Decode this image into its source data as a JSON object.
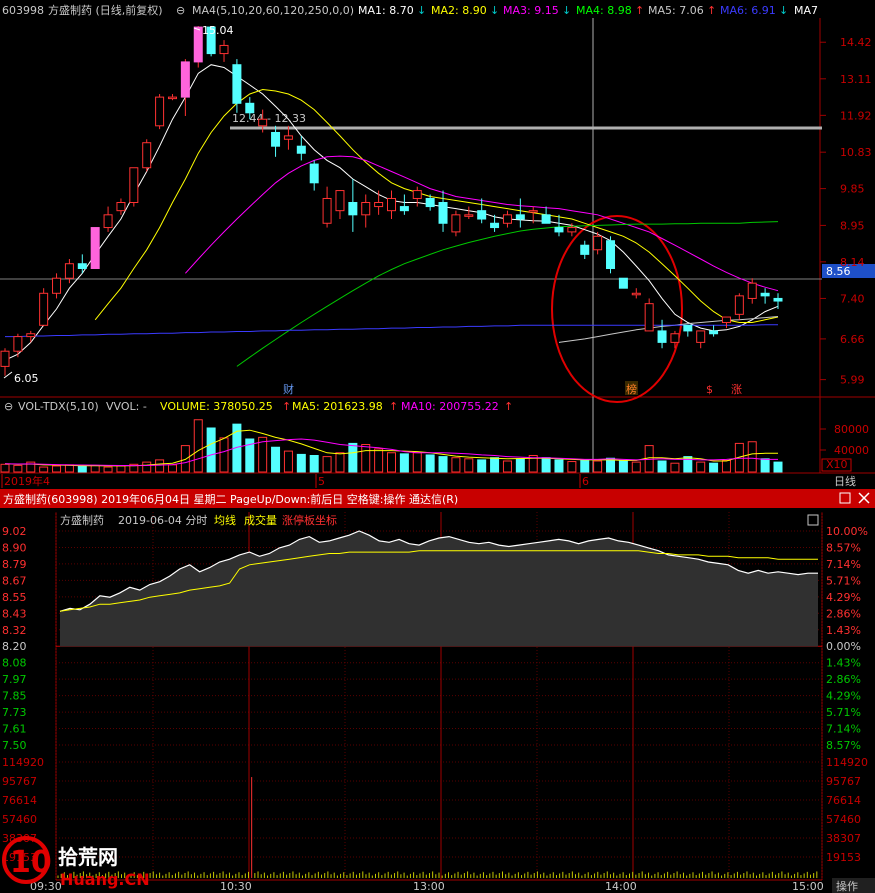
{
  "header": {
    "code": "603998",
    "name_period": "方盛制药 (日线,前复权)",
    "ma_label": "MA4(5,10,20,60,120,250,0,0)",
    "ma_items": [
      {
        "label": "MA1: 8.70",
        "arrow": "↓",
        "color": "#ffffff"
      },
      {
        "label": "MA2: 8.90",
        "arrow": "↓",
        "color": "#ffff00"
      },
      {
        "label": "MA3: 9.15",
        "arrow": "↓",
        "color": "#ff00ff"
      },
      {
        "label": "MA4: 8.98",
        "arrow": "↑",
        "color": "#00ff00"
      },
      {
        "label": "MA5: 7.06",
        "arrow": "↑",
        "color": "#c8c8c8"
      },
      {
        "label": "MA6: 6.91",
        "arrow": "↓",
        "color": "#3b3bff"
      },
      {
        "label": "MA7",
        "arrow": "",
        "color": "#ffffff"
      }
    ]
  },
  "daily": {
    "y_ticks": [
      "14.42",
      "13.11",
      "11.92",
      "10.83",
      "9.85",
      "8.95",
      "8.14",
      "7.40",
      "6.66",
      "5.99"
    ],
    "current_price_label": "8.56",
    "high_label": "15.04",
    "low_label": "6.05",
    "gap_label": "12.44 - 12.33",
    "month_labels": [
      "2019年4",
      "5",
      "6"
    ],
    "markers": [
      {
        "text": "财",
        "color": "#6495ed"
      },
      {
        "text": "榜",
        "color": "#ff7f27"
      },
      {
        "text": "$",
        "color": "#ff3030"
      },
      {
        "text": "涨",
        "color": "#ff3030"
      }
    ],
    "period_label": "日线"
  },
  "volume": {
    "title": "VOL-TDX(5,10)",
    "vvol": "VVOL: -",
    "volume_label": "VOLUME: 378050.25",
    "ma5_label": "MA5: 201623.98",
    "ma10_label": "MA10: 200755.22",
    "arrow": "↑",
    "y_ticks": [
      "80000",
      "40000"
    ],
    "unit": "X10"
  },
  "window_bar": {
    "title": "方盛制药(603998) 2019年06月04日 星期二 PageUp/Down:前后日 空格键:操作 通达信(R)"
  },
  "intraday": {
    "name": "方盛制药",
    "date": "2019-06-04 分时",
    "avg_label": "均线",
    "vol_label": "成交量",
    "limit_label": "涨停板坐标",
    "price_ticks": [
      "9.02",
      "8.90",
      "8.79",
      "8.67",
      "8.55",
      "8.43",
      "8.32",
      "8.20",
      "8.08",
      "7.97",
      "7.85",
      "7.73",
      "7.61",
      "7.50"
    ],
    "pct_ticks": [
      "10.00%",
      "8.57%",
      "7.14%",
      "5.71%",
      "4.29%",
      "2.86%",
      "1.43%",
      "0.00%",
      "1.43%",
      "2.86%",
      "4.29%",
      "5.71%",
      "7.14%",
      "8.57%"
    ],
    "vol_ticks": [
      "114920",
      "95767",
      "76614",
      "57460",
      "38307",
      "19153"
    ],
    "time_labels": [
      "09:30",
      "10:30",
      "13:00",
      "14:00",
      "15:00"
    ],
    "operate_label": "操作",
    "watermark_brand": "拾荒网",
    "watermark_url": "Huang.CN"
  },
  "chart_data": [
    {
      "type": "candlestick",
      "title": "603998 方盛制药 日线 前复权",
      "ylim": [
        5.8,
        15.2
      ],
      "y_scale": "log",
      "candles": [
        [
          6.2,
          6.5,
          6.05,
          6.45
        ],
        [
          6.45,
          6.75,
          6.35,
          6.7
        ],
        [
          6.7,
          6.8,
          6.6,
          6.75
        ],
        [
          6.9,
          7.6,
          6.9,
          7.5
        ],
        [
          7.5,
          7.9,
          7.4,
          7.8
        ],
        [
          7.8,
          8.2,
          7.7,
          8.1
        ],
        [
          8.1,
          8.3,
          7.9,
          8.0
        ],
        [
          8.0,
          8.9,
          8.0,
          8.9
        ],
        [
          8.9,
          9.4,
          8.8,
          9.2
        ],
        [
          9.3,
          9.6,
          9.2,
          9.5
        ],
        [
          9.5,
          10.4,
          9.4,
          10.4
        ],
        [
          10.4,
          11.2,
          10.3,
          11.1
        ],
        [
          11.6,
          12.6,
          11.5,
          12.5
        ],
        [
          12.5,
          12.6,
          12.4,
          12.5
        ],
        [
          12.5,
          13.8,
          11.9,
          13.7
        ],
        [
          13.7,
          15.04,
          13.5,
          15.0
        ],
        [
          15.0,
          15.0,
          13.9,
          14.0
        ],
        [
          14.0,
          14.5,
          13.7,
          14.3
        ],
        [
          13.6,
          13.8,
          12.0,
          12.3
        ],
        [
          12.3,
          12.5,
          11.8,
          12.0
        ],
        [
          11.6,
          12.1,
          11.4,
          11.8
        ],
        [
          11.4,
          11.6,
          10.7,
          11.0
        ],
        [
          11.2,
          11.6,
          10.9,
          11.3
        ],
        [
          11.0,
          11.3,
          10.6,
          10.8
        ],
        [
          10.5,
          10.6,
          9.8,
          10.0
        ],
        [
          9.0,
          9.9,
          8.9,
          9.6
        ],
        [
          9.3,
          9.8,
          9.1,
          9.8
        ],
        [
          9.5,
          10.1,
          8.8,
          9.2
        ],
        [
          9.2,
          9.7,
          8.9,
          9.5
        ],
        [
          9.4,
          9.8,
          9.2,
          9.5
        ],
        [
          9.3,
          9.8,
          9.1,
          9.6
        ],
        [
          9.4,
          9.7,
          9.2,
          9.3
        ],
        [
          9.6,
          9.9,
          9.4,
          9.8
        ],
        [
          9.6,
          9.7,
          9.3,
          9.4
        ],
        [
          9.5,
          9.8,
          8.8,
          9.0
        ],
        [
          8.8,
          9.3,
          8.7,
          9.2
        ],
        [
          9.2,
          9.4,
          9.1,
          9.2
        ],
        [
          9.3,
          9.6,
          9.0,
          9.1
        ],
        [
          9.0,
          9.2,
          8.8,
          8.9
        ],
        [
          9.0,
          9.3,
          8.9,
          9.2
        ],
        [
          9.2,
          9.6,
          8.9,
          9.1
        ],
        [
          9.3,
          9.4,
          9.0,
          9.3
        ],
        [
          9.2,
          9.4,
          9.0,
          9.0
        ],
        [
          8.9,
          9.2,
          8.7,
          8.8
        ],
        [
          8.8,
          9.0,
          8.7,
          8.9
        ],
        [
          8.5,
          8.6,
          8.2,
          8.3
        ],
        [
          8.4,
          8.8,
          8.3,
          8.7
        ],
        [
          8.6,
          8.7,
          7.9,
          8.0
        ],
        [
          7.8,
          7.8,
          7.6,
          7.6
        ],
        [
          7.5,
          7.6,
          7.4,
          7.5
        ],
        [
          6.8,
          7.4,
          6.8,
          7.3
        ],
        [
          6.8,
          7.0,
          6.5,
          6.6
        ],
        [
          6.6,
          6.8,
          6.5,
          6.75
        ],
        [
          6.9,
          6.9,
          6.7,
          6.8
        ],
        [
          6.6,
          6.8,
          6.5,
          6.8
        ],
        [
          6.8,
          6.9,
          6.7,
          6.75
        ],
        [
          6.95,
          7.05,
          6.85,
          7.05
        ],
        [
          7.1,
          7.5,
          7.0,
          7.45
        ],
        [
          7.4,
          7.8,
          7.3,
          7.7
        ],
        [
          7.5,
          7.6,
          7.3,
          7.45
        ],
        [
          7.4,
          7.5,
          7.2,
          7.35
        ]
      ],
      "ma": {
        "MA1": [
          6.3,
          6.4,
          6.6,
          6.9,
          7.2,
          7.6,
          7.9,
          8.3,
          8.7,
          9.1,
          9.7,
          10.3,
          11.0,
          11.8,
          12.5,
          13.3,
          13.6,
          13.5,
          13.2,
          12.9,
          12.6,
          12.2,
          11.8,
          11.3,
          10.9,
          10.6,
          10.4,
          10.1,
          9.9,
          9.7,
          9.55,
          9.5,
          9.5,
          9.45,
          9.4,
          9.35,
          9.3,
          9.25,
          9.15,
          9.1,
          9.08,
          9.06,
          9.05,
          9.0,
          8.95,
          8.85,
          8.75,
          8.6,
          8.35,
          8.05,
          7.75,
          7.4,
          7.1,
          6.95,
          6.85,
          6.8,
          6.82,
          6.88,
          7.0,
          7.15,
          7.25
        ],
        "MA2": [
          null,
          null,
          null,
          null,
          null,
          null,
          null,
          7.0,
          7.3,
          7.6,
          8.0,
          8.4,
          8.9,
          9.5,
          10.1,
          10.8,
          11.4,
          11.9,
          12.3,
          12.6,
          12.75,
          12.7,
          12.6,
          12.4,
          12.1,
          11.7,
          11.3,
          10.9,
          10.55,
          10.25,
          10.0,
          9.85,
          9.75,
          9.65,
          9.6,
          9.55,
          9.5,
          9.45,
          9.4,
          9.35,
          9.3,
          9.25,
          9.2,
          9.15,
          9.1,
          9.0,
          8.9,
          8.8,
          8.7,
          8.55,
          8.35,
          8.1,
          7.85,
          7.6,
          7.35,
          7.15,
          7.0,
          6.95,
          6.95,
          7.0,
          7.05
        ],
        "MA3": [
          null,
          null,
          null,
          null,
          null,
          null,
          null,
          null,
          null,
          null,
          null,
          null,
          null,
          null,
          7.9,
          8.2,
          8.5,
          8.8,
          9.1,
          9.4,
          9.7,
          10.0,
          10.25,
          10.45,
          10.6,
          10.7,
          10.72,
          10.7,
          10.6,
          10.45,
          10.3,
          10.15,
          10.0,
          9.85,
          9.75,
          9.65,
          9.6,
          9.55,
          9.5,
          9.45,
          9.42,
          9.4,
          9.37,
          9.35,
          9.3,
          9.25,
          9.2,
          9.1,
          9.0,
          8.9,
          8.8,
          8.65,
          8.5,
          8.35,
          8.2,
          8.05,
          7.92,
          7.8,
          7.7,
          7.62,
          7.55
        ],
        "MA4": [
          null,
          null,
          null,
          null,
          null,
          null,
          null,
          null,
          null,
          null,
          null,
          null,
          null,
          null,
          null,
          null,
          null,
          null,
          6.2,
          6.35,
          6.5,
          6.65,
          6.8,
          6.95,
          7.1,
          7.25,
          7.4,
          7.55,
          7.7,
          7.85,
          7.98,
          8.1,
          8.2,
          8.3,
          8.4,
          8.48,
          8.56,
          8.63,
          8.7,
          8.76,
          8.82,
          8.86,
          8.89,
          8.92,
          8.93,
          8.94,
          8.95,
          8.96,
          8.97,
          8.98,
          8.98,
          8.98,
          8.99,
          8.99,
          9.0,
          9.0,
          9.0,
          9.0,
          9.02,
          9.03,
          9.04
        ],
        "MA5": [
          null,
          null,
          null,
          null,
          null,
          null,
          null,
          null,
          null,
          null,
          null,
          null,
          null,
          null,
          null,
          null,
          null,
          null,
          null,
          null,
          null,
          null,
          null,
          null,
          null,
          null,
          null,
          null,
          null,
          null,
          null,
          null,
          null,
          null,
          null,
          null,
          null,
          null,
          null,
          null,
          null,
          null,
          null,
          6.6,
          6.63,
          6.66,
          6.7,
          6.74,
          6.78,
          6.82,
          6.85,
          6.88,
          6.9,
          6.93,
          6.95,
          6.97,
          6.99,
          7.0,
          7.02,
          7.04,
          7.06
        ],
        "MA6": [
          6.7,
          6.7,
          6.71,
          6.71,
          6.72,
          6.72,
          6.73,
          6.73,
          6.74,
          6.74,
          6.75,
          6.75,
          6.76,
          6.76,
          6.77,
          6.77,
          6.78,
          6.78,
          6.79,
          6.79,
          6.8,
          6.8,
          6.81,
          6.81,
          6.82,
          6.82,
          6.83,
          6.83,
          6.84,
          6.84,
          6.85,
          6.85,
          6.86,
          6.86,
          6.87,
          6.87,
          6.88,
          6.88,
          6.89,
          6.89,
          6.9,
          6.9,
          6.9,
          6.9,
          6.9,
          6.9,
          6.9,
          6.9,
          6.9,
          6.9,
          6.9,
          6.9,
          6.9,
          6.9,
          6.9,
          6.9,
          6.9,
          6.9,
          6.9,
          6.91,
          6.91
        ]
      }
    },
    {
      "type": "bar",
      "title": "VOL-TDX(5,10)",
      "unit": "X10",
      "ylim": [
        0,
        100000
      ],
      "values": [
        14000,
        12000,
        18000,
        9000,
        11000,
        13000,
        10000,
        12000,
        9000,
        11000,
        14000,
        18000,
        22000,
        13000,
        48000,
        95000,
        80000,
        62000,
        87000,
        60000,
        63000,
        45000,
        38000,
        32000,
        30000,
        28000,
        35000,
        52000,
        50000,
        42000,
        35000,
        33000,
        35000,
        31000,
        28000,
        26000,
        24000,
        22000,
        26000,
        20000,
        24000,
        30000,
        26000,
        22000,
        19000,
        22000,
        20000,
        25000,
        21000,
        18000,
        48000,
        20000,
        16000,
        28000,
        18000,
        16000,
        21000,
        52000,
        55000,
        24000,
        18000
      ],
      "ma5": [
        15000,
        14000,
        14500,
        13000,
        12800,
        12000,
        11500,
        11200,
        11000,
        11000,
        11500,
        12500,
        14500,
        16000,
        23000,
        39000,
        51000,
        61000,
        74000,
        76000,
        70000,
        63000,
        58000,
        51000,
        43000,
        35000,
        33000,
        35000,
        39000,
        39000,
        39000,
        38000,
        37000,
        35000,
        32000,
        29000,
        27000,
        26000,
        25000,
        24000,
        24500,
        25000,
        25000,
        24000,
        23000,
        22000,
        22000,
        22000,
        21000,
        21000,
        26000,
        26000,
        24000,
        26000,
        24000,
        20000,
        20000,
        27000,
        33000,
        34000,
        34000
      ],
      "ma10": [
        15000,
        14500,
        14800,
        14000,
        13500,
        13000,
        12800,
        12500,
        12000,
        11800,
        11700,
        11800,
        12500,
        13500,
        17000,
        24000,
        31000,
        37000,
        45000,
        50000,
        55000,
        57000,
        59000,
        60000,
        58000,
        54000,
        50000,
        48000,
        46000,
        44000,
        41000,
        37000,
        35000,
        35000,
        35000,
        34000,
        33000,
        31000,
        30000,
        28000,
        27000,
        26000,
        26000,
        25000,
        24000,
        23000,
        23000,
        24000,
        23000,
        22000,
        23000,
        24000,
        23000,
        23000,
        22000,
        22000,
        23000,
        25000,
        25000,
        23000,
        23000
      ]
    },
    {
      "type": "line",
      "title": "方盛制药 2019-06-04 分时",
      "ylim": [
        7.38,
        9.02
      ],
      "prev_close": 8.2,
      "price": [
        8.45,
        8.47,
        8.46,
        8.5,
        8.56,
        8.55,
        8.58,
        8.62,
        8.6,
        8.64,
        8.66,
        8.7,
        8.75,
        8.78,
        8.73,
        8.76,
        8.8,
        8.82,
        8.85,
        8.87,
        8.84,
        8.86,
        8.9,
        8.92,
        8.96,
        8.98,
        8.94,
        8.95,
        8.97,
        8.99,
        9.02,
        8.99,
        8.95,
        8.94,
        8.96,
        8.93,
        8.92,
        8.95,
        8.97,
        8.98,
        8.96,
        8.94,
        8.93,
        8.94,
        8.92,
        8.91,
        8.92,
        8.93,
        8.94,
        8.95,
        8.96,
        8.95,
        8.93,
        8.95,
        8.96,
        8.97,
        8.95,
        8.94,
        8.92,
        8.9,
        8.88,
        8.85,
        8.84,
        8.83,
        8.82,
        8.8,
        8.79,
        8.78,
        8.74,
        8.72,
        8.74,
        8.72,
        8.73,
        8.72,
        8.71,
        8.72,
        8.72
      ],
      "avg": [
        8.45,
        8.46,
        8.47,
        8.48,
        8.5,
        8.5,
        8.51,
        8.52,
        8.53,
        8.55,
        8.56,
        8.57,
        8.58,
        8.6,
        8.61,
        8.62,
        8.63,
        8.65,
        8.75,
        8.78,
        8.79,
        8.8,
        8.81,
        8.82,
        8.83,
        8.84,
        8.85,
        8.86,
        8.86,
        8.87,
        8.87,
        8.87,
        8.87,
        8.87,
        8.87,
        8.87,
        8.88,
        8.88,
        8.88,
        8.88,
        8.88,
        8.88,
        8.88,
        8.88,
        8.88,
        8.88,
        8.88,
        8.88,
        8.88,
        8.88,
        8.88,
        8.88,
        8.88,
        8.88,
        8.88,
        8.88,
        8.88,
        8.88,
        8.88,
        8.87,
        8.86,
        8.86,
        8.85,
        8.85,
        8.85,
        8.84,
        8.84,
        8.84,
        8.83,
        8.83,
        8.83,
        8.83,
        8.82,
        8.82,
        8.82,
        8.82,
        8.82
      ],
      "volume_ylim": [
        0,
        114920
      ],
      "volume_spike": {
        "time": "10:31",
        "value": 100000
      }
    }
  ]
}
